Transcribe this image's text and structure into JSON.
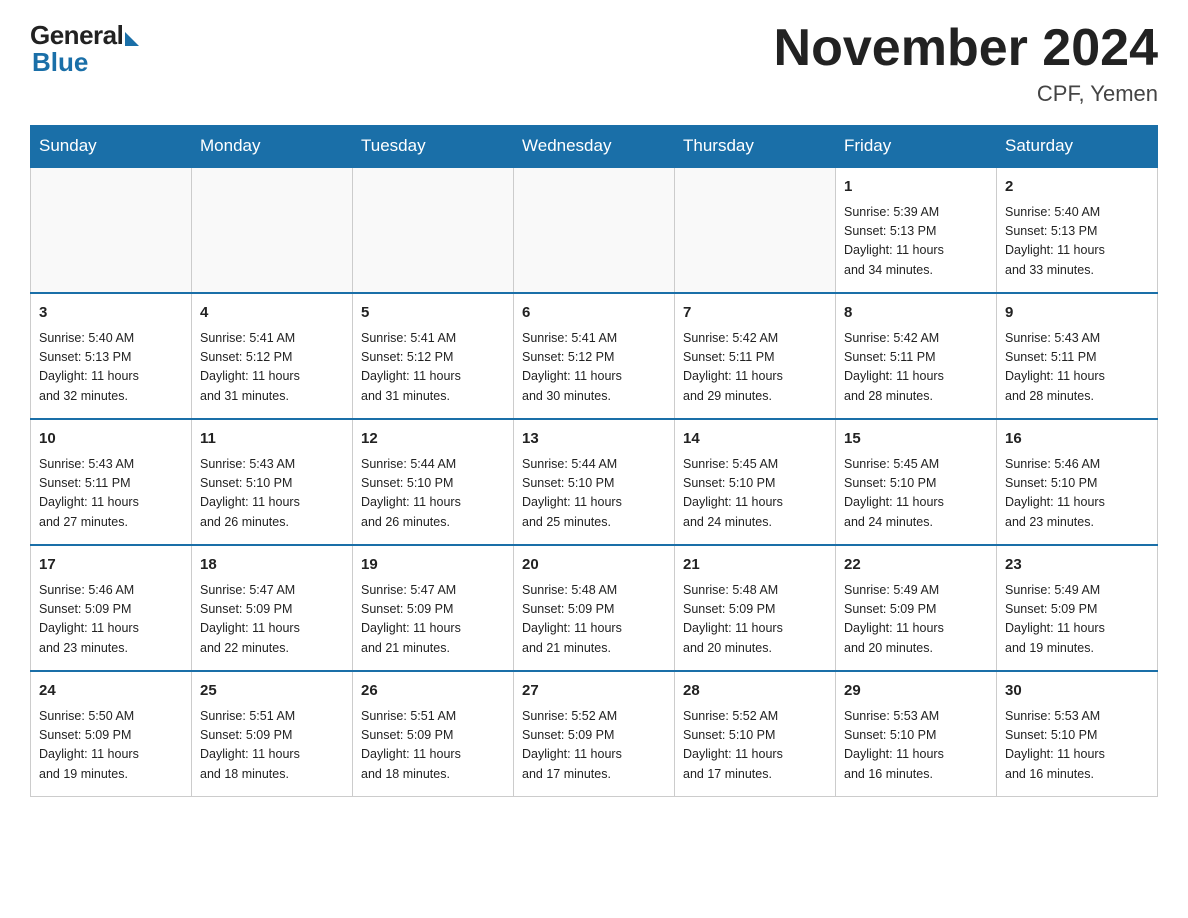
{
  "logo": {
    "general": "General",
    "blue": "Blue"
  },
  "title": "November 2024",
  "subtitle": "CPF, Yemen",
  "days_of_week": [
    "Sunday",
    "Monday",
    "Tuesday",
    "Wednesday",
    "Thursday",
    "Friday",
    "Saturday"
  ],
  "weeks": [
    [
      {
        "day": "",
        "info": ""
      },
      {
        "day": "",
        "info": ""
      },
      {
        "day": "",
        "info": ""
      },
      {
        "day": "",
        "info": ""
      },
      {
        "day": "",
        "info": ""
      },
      {
        "day": "1",
        "info": "Sunrise: 5:39 AM\nSunset: 5:13 PM\nDaylight: 11 hours\nand 34 minutes."
      },
      {
        "day": "2",
        "info": "Sunrise: 5:40 AM\nSunset: 5:13 PM\nDaylight: 11 hours\nand 33 minutes."
      }
    ],
    [
      {
        "day": "3",
        "info": "Sunrise: 5:40 AM\nSunset: 5:13 PM\nDaylight: 11 hours\nand 32 minutes."
      },
      {
        "day": "4",
        "info": "Sunrise: 5:41 AM\nSunset: 5:12 PM\nDaylight: 11 hours\nand 31 minutes."
      },
      {
        "day": "5",
        "info": "Sunrise: 5:41 AM\nSunset: 5:12 PM\nDaylight: 11 hours\nand 31 minutes."
      },
      {
        "day": "6",
        "info": "Sunrise: 5:41 AM\nSunset: 5:12 PM\nDaylight: 11 hours\nand 30 minutes."
      },
      {
        "day": "7",
        "info": "Sunrise: 5:42 AM\nSunset: 5:11 PM\nDaylight: 11 hours\nand 29 minutes."
      },
      {
        "day": "8",
        "info": "Sunrise: 5:42 AM\nSunset: 5:11 PM\nDaylight: 11 hours\nand 28 minutes."
      },
      {
        "day": "9",
        "info": "Sunrise: 5:43 AM\nSunset: 5:11 PM\nDaylight: 11 hours\nand 28 minutes."
      }
    ],
    [
      {
        "day": "10",
        "info": "Sunrise: 5:43 AM\nSunset: 5:11 PM\nDaylight: 11 hours\nand 27 minutes."
      },
      {
        "day": "11",
        "info": "Sunrise: 5:43 AM\nSunset: 5:10 PM\nDaylight: 11 hours\nand 26 minutes."
      },
      {
        "day": "12",
        "info": "Sunrise: 5:44 AM\nSunset: 5:10 PM\nDaylight: 11 hours\nand 26 minutes."
      },
      {
        "day": "13",
        "info": "Sunrise: 5:44 AM\nSunset: 5:10 PM\nDaylight: 11 hours\nand 25 minutes."
      },
      {
        "day": "14",
        "info": "Sunrise: 5:45 AM\nSunset: 5:10 PM\nDaylight: 11 hours\nand 24 minutes."
      },
      {
        "day": "15",
        "info": "Sunrise: 5:45 AM\nSunset: 5:10 PM\nDaylight: 11 hours\nand 24 minutes."
      },
      {
        "day": "16",
        "info": "Sunrise: 5:46 AM\nSunset: 5:10 PM\nDaylight: 11 hours\nand 23 minutes."
      }
    ],
    [
      {
        "day": "17",
        "info": "Sunrise: 5:46 AM\nSunset: 5:09 PM\nDaylight: 11 hours\nand 23 minutes."
      },
      {
        "day": "18",
        "info": "Sunrise: 5:47 AM\nSunset: 5:09 PM\nDaylight: 11 hours\nand 22 minutes."
      },
      {
        "day": "19",
        "info": "Sunrise: 5:47 AM\nSunset: 5:09 PM\nDaylight: 11 hours\nand 21 minutes."
      },
      {
        "day": "20",
        "info": "Sunrise: 5:48 AM\nSunset: 5:09 PM\nDaylight: 11 hours\nand 21 minutes."
      },
      {
        "day": "21",
        "info": "Sunrise: 5:48 AM\nSunset: 5:09 PM\nDaylight: 11 hours\nand 20 minutes."
      },
      {
        "day": "22",
        "info": "Sunrise: 5:49 AM\nSunset: 5:09 PM\nDaylight: 11 hours\nand 20 minutes."
      },
      {
        "day": "23",
        "info": "Sunrise: 5:49 AM\nSunset: 5:09 PM\nDaylight: 11 hours\nand 19 minutes."
      }
    ],
    [
      {
        "day": "24",
        "info": "Sunrise: 5:50 AM\nSunset: 5:09 PM\nDaylight: 11 hours\nand 19 minutes."
      },
      {
        "day": "25",
        "info": "Sunrise: 5:51 AM\nSunset: 5:09 PM\nDaylight: 11 hours\nand 18 minutes."
      },
      {
        "day": "26",
        "info": "Sunrise: 5:51 AM\nSunset: 5:09 PM\nDaylight: 11 hours\nand 18 minutes."
      },
      {
        "day": "27",
        "info": "Sunrise: 5:52 AM\nSunset: 5:09 PM\nDaylight: 11 hours\nand 17 minutes."
      },
      {
        "day": "28",
        "info": "Sunrise: 5:52 AM\nSunset: 5:10 PM\nDaylight: 11 hours\nand 17 minutes."
      },
      {
        "day": "29",
        "info": "Sunrise: 5:53 AM\nSunset: 5:10 PM\nDaylight: 11 hours\nand 16 minutes."
      },
      {
        "day": "30",
        "info": "Sunrise: 5:53 AM\nSunset: 5:10 PM\nDaylight: 11 hours\nand 16 minutes."
      }
    ]
  ]
}
